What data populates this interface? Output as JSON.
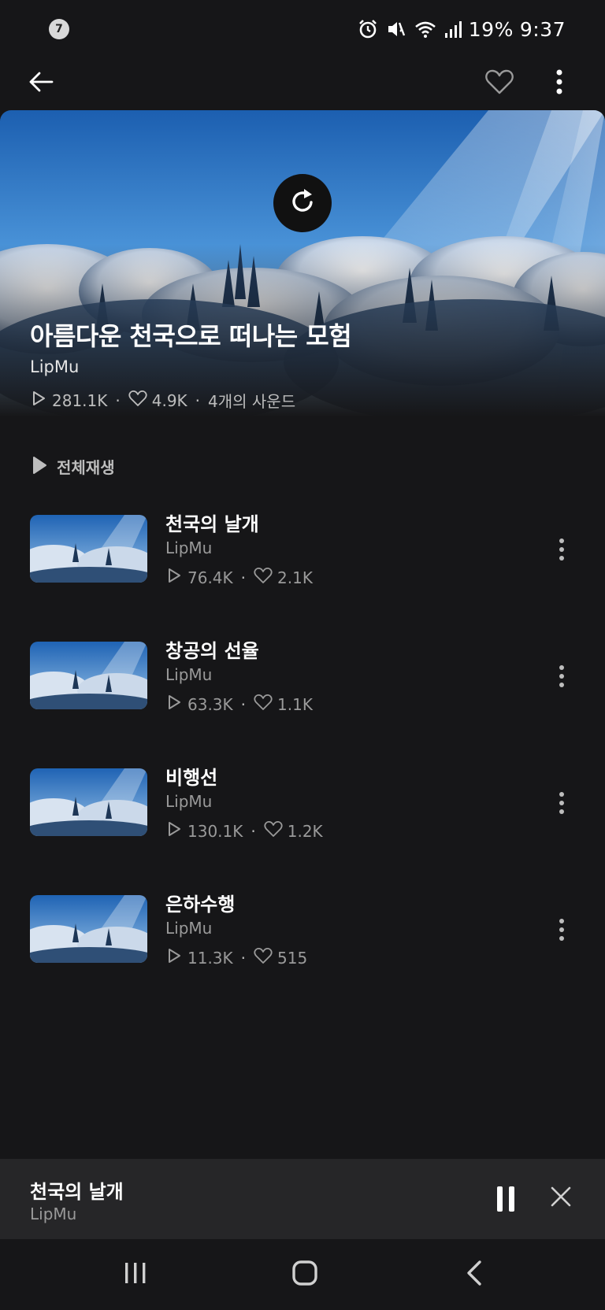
{
  "status_bar": {
    "notification_count": "7",
    "battery": "19%",
    "time": "9:37",
    "icons": [
      "alarm-icon",
      "mute-icon",
      "wifi-icon",
      "signal-icon"
    ]
  },
  "app_bar": {
    "back_icon": "arrow-left-icon",
    "favorite_icon": "heart-outline-icon",
    "more_icon": "more-vertical-icon"
  },
  "playlist": {
    "title": "아름다운 천국으로 떠나는 모험",
    "artist": "LipMu",
    "plays": "281.1K",
    "likes": "4.9K",
    "sound_count": "4개의 사운드"
  },
  "play_all_label": "전체재생",
  "tracks": [
    {
      "title": "천국의 날개",
      "artist": "LipMu",
      "plays": "76.4K",
      "likes": "2.1K"
    },
    {
      "title": "창공의 선율",
      "artist": "LipMu",
      "plays": "63.3K",
      "likes": "1.1K"
    },
    {
      "title": "비행선",
      "artist": "LipMu",
      "plays": "130.1K",
      "likes": "1.2K"
    },
    {
      "title": "은하수행",
      "artist": "LipMu",
      "plays": "11.3K",
      "likes": "515"
    }
  ],
  "mini_player": {
    "title": "천국의 날개",
    "artist": "LipMu"
  },
  "colors": {
    "background": "#161618",
    "mini_player_bg": "#262628",
    "secondary_text": "#9a9a9a"
  }
}
